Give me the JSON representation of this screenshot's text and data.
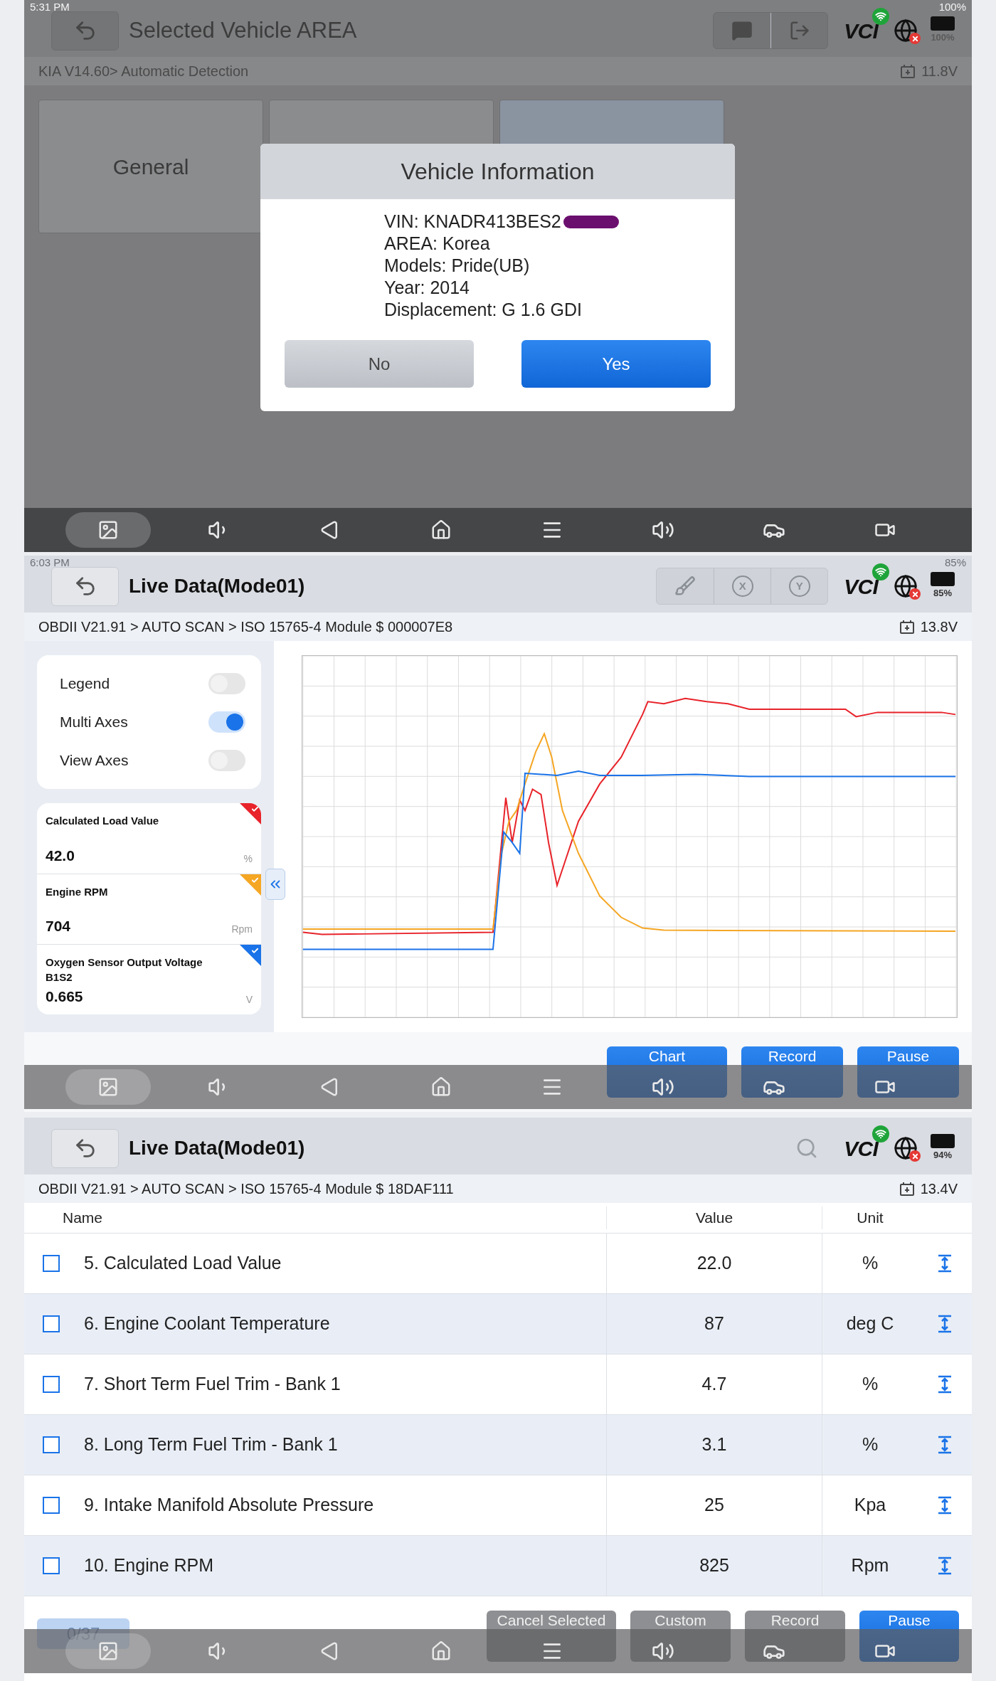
{
  "vehicle_screen": {
    "status_bar": {
      "time": "5:31 PM",
      "battery": "100%"
    },
    "title": "Selected Vehicle AREA",
    "tools": [
      {
        "kind": "message"
      },
      {
        "kind": "exit"
      }
    ],
    "vci": "VCI",
    "battery_label": "100%",
    "breadcrumb": "KIA V14.60> Automatic Detection",
    "voltage": "11.8V",
    "tiles": [
      {
        "label": "General"
      }
    ],
    "dialog": {
      "title": "Vehicle Information",
      "lines": [
        "VIN: KNADR413BES2",
        "AREA: Korea",
        "Models: Pride(UB)",
        "Year: 2014",
        "Displacement: G 1.6 GDI"
      ],
      "buttons": [
        {
          "label": "No",
          "kind": "secondary"
        },
        {
          "label": "Yes",
          "kind": "primary"
        }
      ]
    }
  },
  "chart_screen": {
    "status_bar": {
      "time": "6:03 PM",
      "battery": "85%"
    },
    "title": "Live Data(Mode01)",
    "tools": [
      {
        "kind": "brush"
      },
      {
        "kind": "zoom",
        "label": "X"
      },
      {
        "kind": "zoom",
        "label": "Y"
      }
    ],
    "vci": "VCI",
    "battery_label": "85%",
    "breadcrumb": "OBDII V21.91 > AUTO SCAN  > ISO 15765-4 Module $ 000007E8",
    "voltage": "13.8V",
    "toggles": [
      {
        "label": "Legend",
        "on": false
      },
      {
        "label": "Multi Axes",
        "on": true
      },
      {
        "label": "View Axes",
        "on": false
      }
    ],
    "sensors": [
      {
        "name": "Calculated Load Value",
        "value": "42.0",
        "unit": "%",
        "color": "#e8232a"
      },
      {
        "name": "Engine RPM",
        "value": "704",
        "unit": "Rpm",
        "color": "#f5a623"
      },
      {
        "name": "Oxygen Sensor Output Voltage B1S2",
        "value": "0.665",
        "unit": "V",
        "color": "#1a73e8"
      }
    ],
    "buttons": [
      {
        "label": "Chart",
        "kind": "primary"
      },
      {
        "label": "Record",
        "kind": "primary"
      },
      {
        "label": "Pause",
        "kind": "primary"
      }
    ]
  },
  "list_screen": {
    "title": "Live Data(Mode01)",
    "tools": [
      {
        "kind": "search"
      }
    ],
    "vci": "VCI",
    "battery_label": "94%",
    "breadcrumb": "OBDII V21.91 > AUTO SCAN  > ISO 15765-4 Module $ 18DAF111",
    "voltage": "13.4V",
    "columns": [
      "Name",
      "Value",
      "Unit"
    ],
    "rows": [
      {
        "name": "5. Calculated Load Value",
        "value": "22.0",
        "unit": "%",
        "checked": false
      },
      {
        "name": "6. Engine Coolant Temperature",
        "value": "87",
        "unit": "deg C",
        "checked": false
      },
      {
        "name": "7. Short Term Fuel Trim - Bank 1",
        "value": "4.7",
        "unit": "%",
        "checked": false
      },
      {
        "name": "8. Long Term Fuel Trim - Bank 1",
        "value": "3.1",
        "unit": "%",
        "checked": false
      },
      {
        "name": "9. Intake Manifold Absolute Pressure",
        "value": "25",
        "unit": "Kpa",
        "checked": false
      },
      {
        "name": "10. Engine RPM",
        "value": "825",
        "unit": "Rpm",
        "checked": false
      }
    ],
    "counter": "0/37",
    "buttons": [
      {
        "label": "Cancel Selected",
        "kind": "disabled"
      },
      {
        "label": "Custom",
        "kind": "disabled"
      },
      {
        "label": "Record",
        "kind": "disabled"
      },
      {
        "label": "Pause",
        "kind": "primary"
      }
    ]
  }
}
